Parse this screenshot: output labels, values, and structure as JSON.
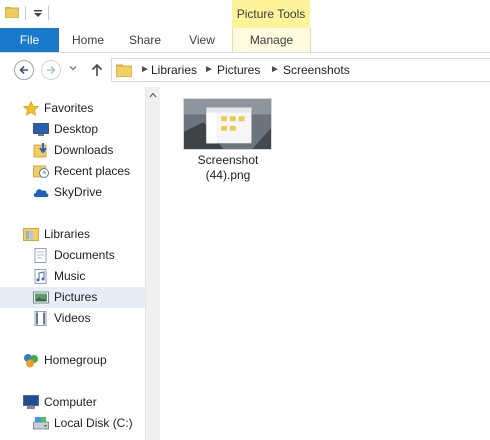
{
  "ribbon": {
    "contextual_header": "Picture Tools",
    "tabs": {
      "file": "File",
      "home": "Home",
      "share": "Share",
      "view": "View",
      "manage": "Manage"
    }
  },
  "address": {
    "breadcrumbs": [
      "Libraries",
      "Pictures",
      "Screenshots"
    ]
  },
  "nav_pane": {
    "favorites": {
      "label": "Favorites",
      "icon": "star-icon"
    },
    "favorites_items": [
      {
        "label": "Desktop",
        "icon": "desktop-icon"
      },
      {
        "label": "Downloads",
        "icon": "downloads-icon"
      },
      {
        "label": "Recent places",
        "icon": "recent-places-icon"
      },
      {
        "label": "SkyDrive",
        "icon": "skydrive-icon"
      }
    ],
    "libraries": {
      "label": "Libraries",
      "icon": "libraries-icon"
    },
    "libraries_items": [
      {
        "label": "Documents",
        "icon": "documents-icon"
      },
      {
        "label": "Music",
        "icon": "music-icon"
      },
      {
        "label": "Pictures",
        "icon": "pictures-icon",
        "selected": true
      },
      {
        "label": "Videos",
        "icon": "videos-icon"
      }
    ],
    "homegroup": {
      "label": "Homegroup",
      "icon": "homegroup-icon"
    },
    "computer": {
      "label": "Computer",
      "icon": "computer-icon"
    },
    "computer_items": [
      {
        "label": "Local Disk (C:)",
        "icon": "local-disk-icon"
      }
    ]
  },
  "files": [
    {
      "name_line1": "Screenshot",
      "name_line2": "(44).png",
      "icon": "image-thumbnail"
    }
  ],
  "colors": {
    "file_tab": "#1979ca",
    "contextual_tab": "#fdf39a",
    "selected_nav": "#e5eef7"
  }
}
